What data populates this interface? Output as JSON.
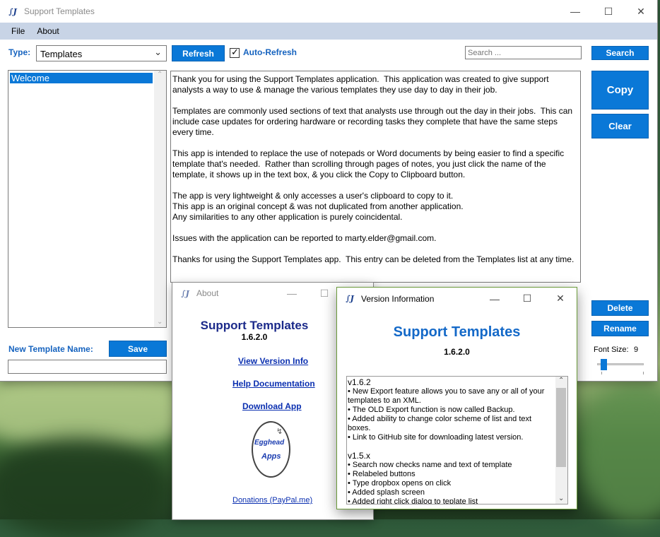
{
  "main_window": {
    "title": "Support Templates",
    "menu": [
      "File",
      "About"
    ],
    "type_label": "Type:",
    "type_value": "Templates",
    "refresh_label": "Refresh",
    "auto_refresh_label": "Auto-Refresh",
    "auto_refresh_checked": true,
    "search_placeholder": "Search ...",
    "search_label": "Search",
    "copy_label": "Copy",
    "clear_label": "Clear",
    "delete_label": "Delete",
    "rename_label": "Rename",
    "font_size_label": "Font Size:",
    "font_size_value": "9",
    "template_list": [
      "Welcome"
    ],
    "new_template_label": "New Template Name:",
    "save_label": "Save",
    "new_template_value": "",
    "body_paragraphs": [
      "Thank you for using the Support Templates application.  This application was created to give support analysts a way to use & manage the various templates they use day to day in their job.",
      "Templates are commonly used sections of text that analysts use through out the day in their jobs.  This can include case updates for ordering hardware or recording tasks they complete that have the same steps every time.",
      "This app is intended to replace the use of notepads or Word documents by being easier to find a specific template that's needed.  Rather than scrolling through pages of notes, you just click the name of the template, it shows up in the text box, & you click the Copy to Clipboard button.",
      "The app is very lightweight & only accesses a user's clipboard to copy to it.\nThis app is an original concept & was not duplicated from another application.\nAny similarities to any other application is purely coincidental.",
      "Issues with the application can be reported to marty.elder@gmail.com.",
      "Thanks for using the Support Templates app.  This entry can be deleted from the Templates list at any time."
    ]
  },
  "about_window": {
    "title": "About",
    "app_name": "Support Templates",
    "version": "1.6.2.0",
    "link_version": "View Version Info",
    "link_help": "Help Documentation",
    "link_download": "Download App",
    "logo_line1": "Egghead",
    "logo_line2": "Apps",
    "donations": "Donations (PayPal.me)"
  },
  "version_window": {
    "title": "Version Information",
    "app_name": "Support Templates",
    "version": "1.6.2.0",
    "notes": [
      {
        "heading": "v1.6.2",
        "items": [
          "• New Export feature allows you to save any or all of your templates to an XML.",
          "• The OLD Export function is now called Backup.",
          "• Added ability to change color scheme of list and text boxes.",
          "• Link to GitHub site for downloading latest version."
        ]
      },
      {
        "heading": "v1.5.x",
        "items": [
          "• Search now checks name and text of template",
          "• Relabeled buttons",
          "• Type dropbox opens on click",
          "• Added splash screen",
          "• Added right click dialog to teplate list"
        ]
      }
    ]
  },
  "colors": {
    "accent": "#0a78d7",
    "label_blue": "#1663bf",
    "title_blue": "#1469c8",
    "menubar": "#c8d4e6",
    "link": "#0a2fb0"
  }
}
